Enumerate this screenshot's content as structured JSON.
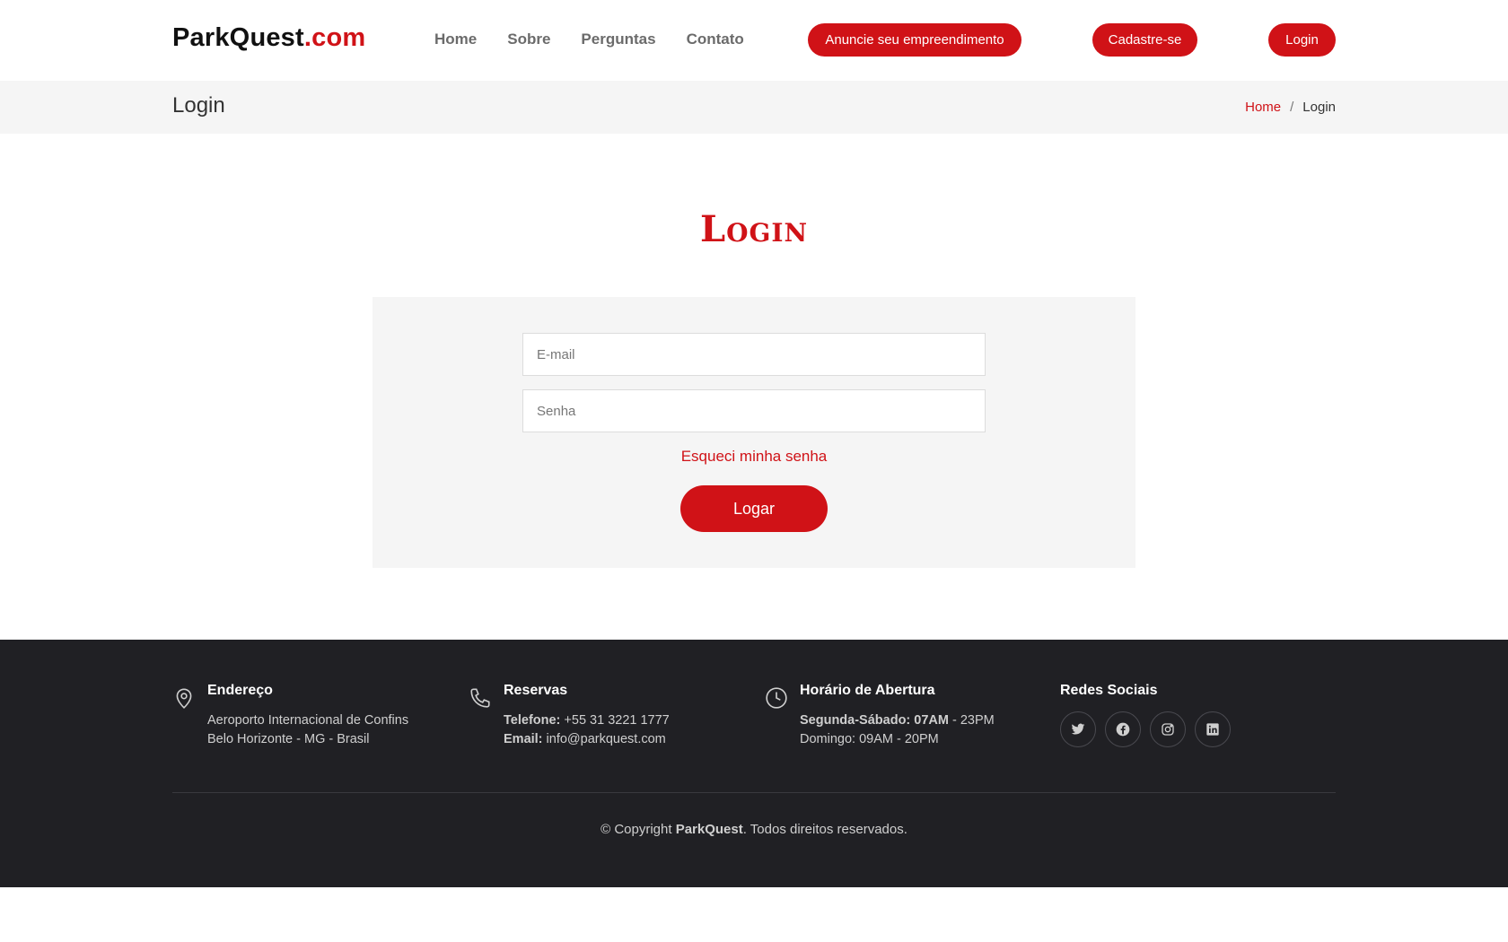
{
  "header": {
    "logo_main": "ParkQuest",
    "logo_suffix": ".com",
    "nav": [
      "Home",
      "Sobre",
      "Perguntas",
      "Contato"
    ],
    "btn_anuncie": "Anuncie seu empreendimento",
    "btn_cadastre": "Cadastre-se",
    "btn_login": "Login"
  },
  "breadcrumb": {
    "title": "Login",
    "home": "Home",
    "separator": "/",
    "current": "Login"
  },
  "form": {
    "heading": "Login",
    "email_placeholder": "E-mail",
    "password_placeholder": "Senha",
    "forgot_link": "Esqueci minha senha",
    "submit_label": "Logar"
  },
  "footer": {
    "address": {
      "icon": "map-pin-icon",
      "title": "Endereço",
      "line1": "Aeroporto Internacional de Confins",
      "line2": "Belo Horizonte - MG - Brasil"
    },
    "reservas": {
      "icon": "phone-icon",
      "title": "Reservas",
      "phone_label": "Telefone:",
      "phone": "+55 31 3221 1777",
      "email_label": "Email:",
      "email": "info@parkquest.com"
    },
    "hours": {
      "icon": "clock-icon",
      "title": "Horário de Abertura",
      "weekday_label": "Segunda-Sábado:",
      "weekday_open": "07AM",
      "weekday_close": "- 23PM",
      "sunday": "Domingo: 09AM - 20PM"
    },
    "social": {
      "title": "Redes Sociais",
      "icons": [
        "twitter-icon",
        "facebook-icon",
        "instagram-icon",
        "linkedin-icon"
      ]
    },
    "copyright_prefix": "© Copyright",
    "copyright_brand": "ParkQuest",
    "copyright_suffix": ". Todos direitos reservados."
  },
  "colors": {
    "accent": "#d01217",
    "footer_bg": "#202024",
    "panel_bg": "#f5f5f5"
  }
}
